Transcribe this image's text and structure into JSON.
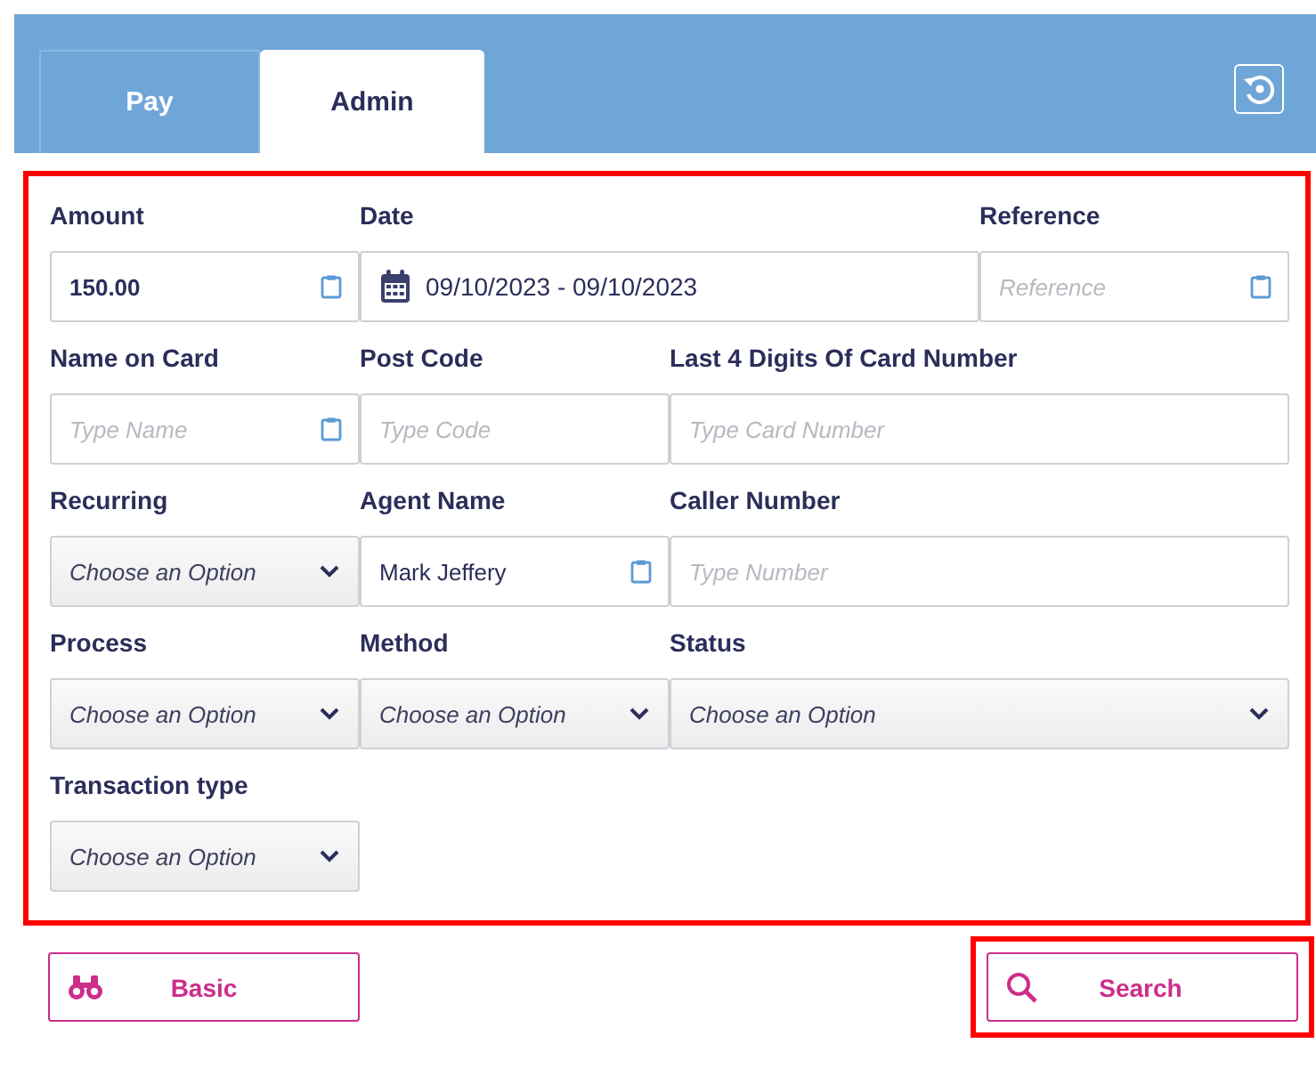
{
  "tabs": [
    {
      "label": "Pay",
      "selected": false
    },
    {
      "label": "Admin",
      "selected": true
    }
  ],
  "form": {
    "highlighted": true,
    "rows": [
      [
        {
          "kind": "text",
          "label": "Amount",
          "value": "150.00",
          "bold": true,
          "paste_icon": true
        },
        {
          "kind": "date",
          "label": "Date",
          "value": "09/10/2023 - 09/10/2023"
        },
        {
          "kind": "text",
          "label": "Reference",
          "placeholder": "Reference",
          "paste_icon": true
        }
      ],
      [
        {
          "kind": "text",
          "label": "Name on Card",
          "placeholder": "Type Name",
          "paste_icon": true
        },
        {
          "kind": "text",
          "label": "Post Code",
          "placeholder": "Type Code",
          "paste_icon": false
        },
        {
          "kind": "text",
          "label": "Last 4 Digits Of Card Number",
          "placeholder": "Type Card Number",
          "paste_icon": false
        }
      ],
      [
        {
          "kind": "select",
          "label": "Recurring",
          "placeholder": "Choose an Option"
        },
        {
          "kind": "text",
          "label": "Agent Name",
          "value": "Mark Jeffery",
          "bold": false,
          "paste_icon": true
        },
        {
          "kind": "text",
          "label": "Caller Number",
          "placeholder": "Type Number",
          "paste_icon": false
        }
      ],
      [
        {
          "kind": "select",
          "label": "Process",
          "placeholder": "Choose an Option"
        },
        {
          "kind": "select",
          "label": "Method",
          "placeholder": "Choose an Option"
        },
        {
          "kind": "select",
          "label": "Status",
          "placeholder": "Choose an Option"
        }
      ],
      [
        {
          "kind": "select",
          "label": "Transaction type",
          "placeholder": "Choose an Option"
        }
      ]
    ]
  },
  "buttons": [
    {
      "kind": "binoculars",
      "label": "Basic",
      "highlighted": false
    },
    {
      "kind": "search",
      "label": "Search",
      "highlighted": true
    }
  ]
}
